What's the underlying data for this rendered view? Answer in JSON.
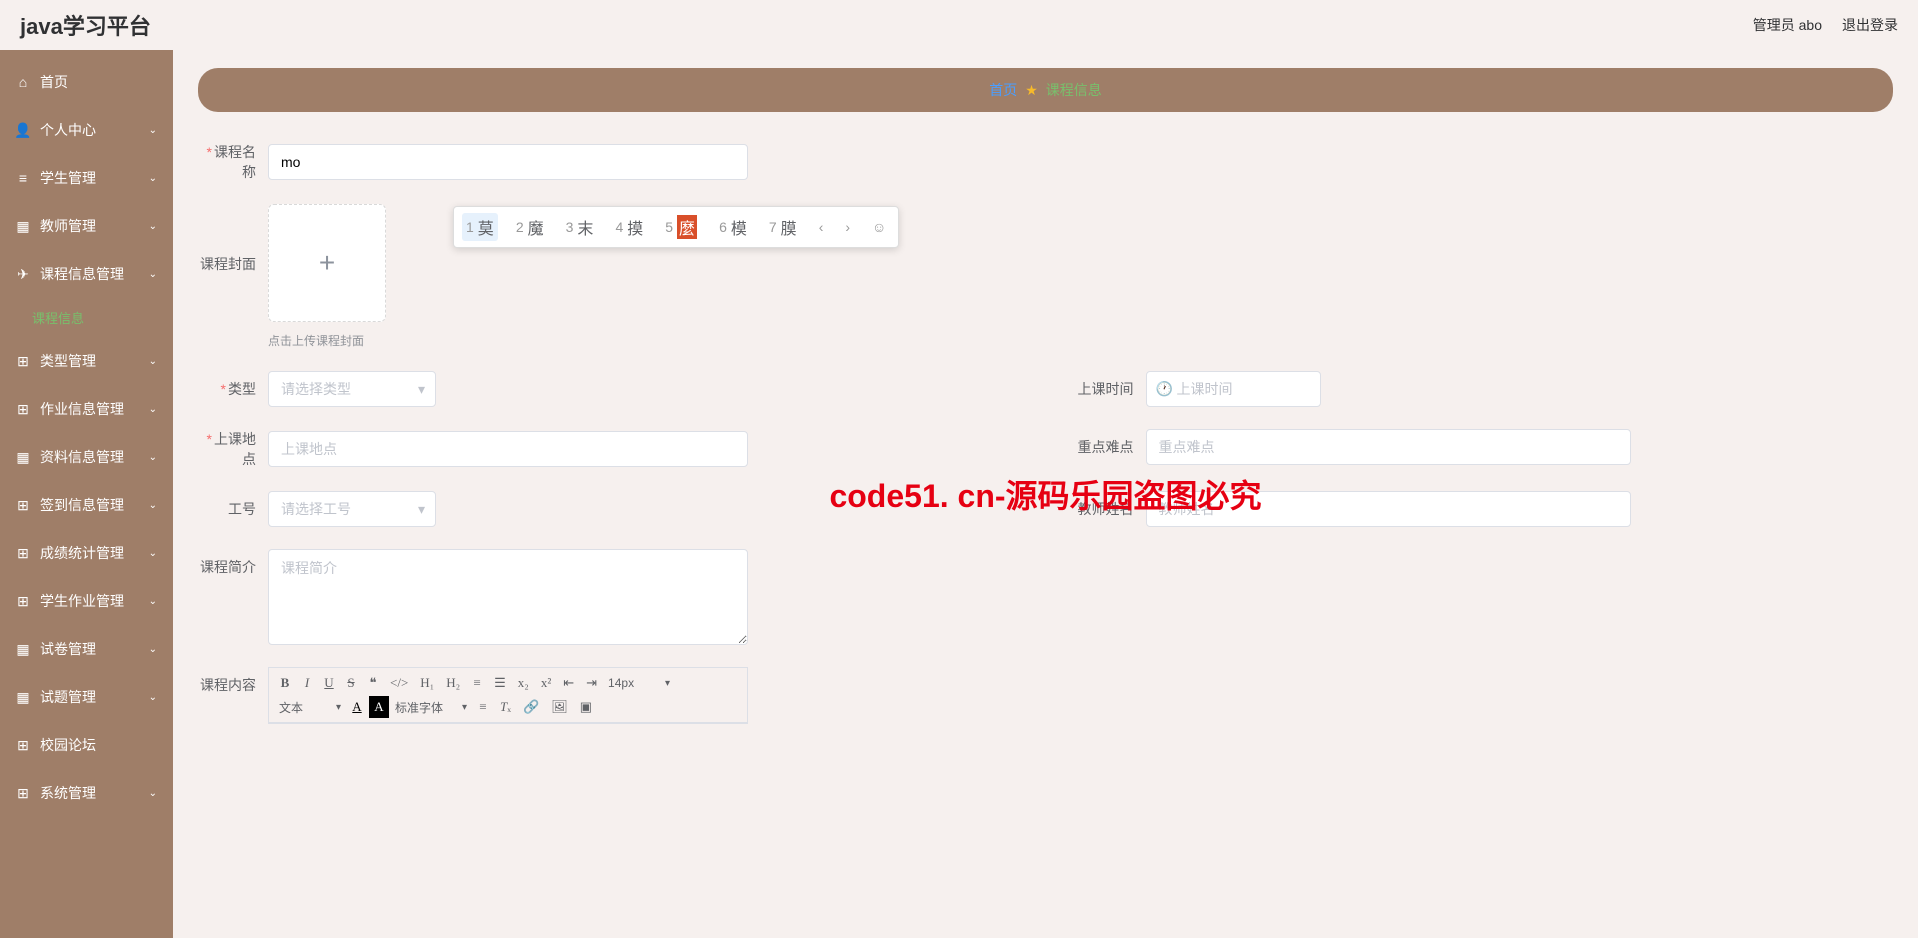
{
  "app": {
    "title": "java学习平台"
  },
  "header": {
    "admin_label": "管理员 abo",
    "logout_label": "退出登录"
  },
  "sidebar": {
    "items": [
      {
        "label": "首页",
        "has_arrow": false
      },
      {
        "label": "个人中心",
        "has_arrow": true
      },
      {
        "label": "学生管理",
        "has_arrow": true
      },
      {
        "label": "教师管理",
        "has_arrow": true
      },
      {
        "label": "课程信息管理",
        "has_arrow": true,
        "sub": "课程信息"
      },
      {
        "label": "类型管理",
        "has_arrow": true
      },
      {
        "label": "作业信息管理",
        "has_arrow": true
      },
      {
        "label": "资料信息管理",
        "has_arrow": true
      },
      {
        "label": "签到信息管理",
        "has_arrow": true
      },
      {
        "label": "成绩统计管理",
        "has_arrow": true
      },
      {
        "label": "学生作业管理",
        "has_arrow": true
      },
      {
        "label": "试卷管理",
        "has_arrow": true
      },
      {
        "label": "试题管理",
        "has_arrow": true
      },
      {
        "label": "校园论坛",
        "has_arrow": false
      },
      {
        "label": "系统管理",
        "has_arrow": true
      }
    ]
  },
  "breadcrumb": {
    "home": "首页",
    "current": "课程信息"
  },
  "form": {
    "course_name_label": "课程名称",
    "course_name_value": "mo",
    "cover_label": "课程封面",
    "cover_hint": "点击上传课程封面",
    "type_label": "类型",
    "type_placeholder": "请选择类型",
    "class_time_label": "上课时间",
    "class_time_placeholder": "上课时间",
    "location_label": "上课地点",
    "location_placeholder": "上课地点",
    "difficulty_label": "重点难点",
    "difficulty_placeholder": "重点难点",
    "emp_id_label": "工号",
    "emp_id_placeholder": "请选择工号",
    "teacher_label": "教师姓名",
    "teacher_placeholder": "教师姓名",
    "intro_label": "课程简介",
    "intro_placeholder": "课程简介",
    "content_label": "课程内容"
  },
  "editor": {
    "font_size": "14px",
    "font_color_label": "文本",
    "font_family_label": "标准字体"
  },
  "ime": {
    "candidates": [
      {
        "num": "1",
        "char": "莫"
      },
      {
        "num": "2",
        "char": "魔"
      },
      {
        "num": "3",
        "char": "末"
      },
      {
        "num": "4",
        "char": "摸"
      },
      {
        "num": "5",
        "char": "麼"
      },
      {
        "num": "6",
        "char": "模"
      },
      {
        "num": "7",
        "char": "膜"
      }
    ]
  },
  "watermark": "code51. cn-源码乐园盗图必究"
}
